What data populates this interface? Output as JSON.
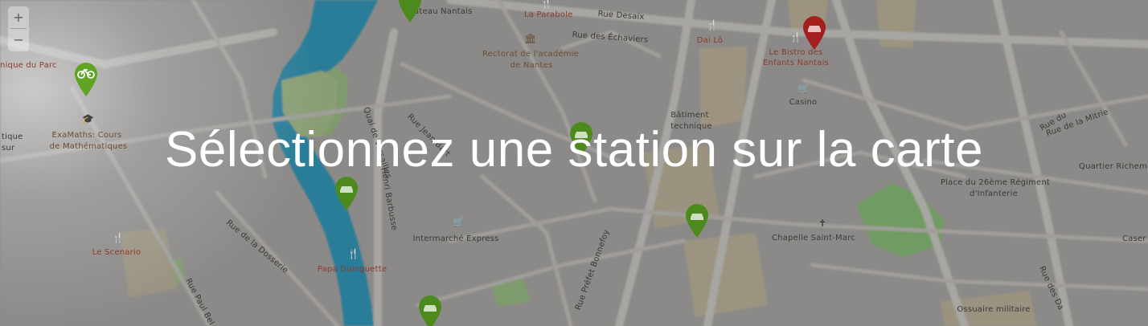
{
  "map": {
    "zoom_in": "+",
    "zoom_out": "−",
    "overlay_message": "Sélectionnez une station sur la carte",
    "labels": {
      "park": "nique du Parc",
      "exa1": "ExaMaths: Cours",
      "exa2": "de Mathématiques",
      "tique": "tique",
      "sur": "sur",
      "scenario": "Le Scenario",
      "bateau": "Bateau Nantais",
      "parabole": "La Parabole",
      "desaix": "Rue Desaix",
      "echaviers": "Rue des Échaviers",
      "rectorat1": "Rectorat de l'académie",
      "rectorat2": "de Nantes",
      "dailo": "Dai Lô",
      "bistro1": "Le Bistro des",
      "bistro2": "Enfants Nantais",
      "casino": "Casino",
      "batiment1": "Bâtiment",
      "batiment2": "technique",
      "mitrie": "Rue de la Mitrie",
      "quartier": "Quartier Richemo",
      "place1": "Place du 26ème Régiment",
      "place2": "d'Infanterie",
      "chapelle": "Chapelle Saint-Marc",
      "caser": "Caser",
      "intermarche": "Intermarché Express",
      "papa": "Papa Guinguette",
      "dosserie": "Rue de la Dosserie",
      "paulbel": "Rue Paul Bel",
      "prefet": "Rue Préfet Bonnefoy",
      "quai": "Quai de Versailles",
      "jeanbart": "Rue Jean Bart",
      "barbusse": "Henri Barbusse",
      "militaire": "Ossuaire militaire",
      "dulac": "Rue des Da",
      "nrue": "Rue du"
    }
  }
}
